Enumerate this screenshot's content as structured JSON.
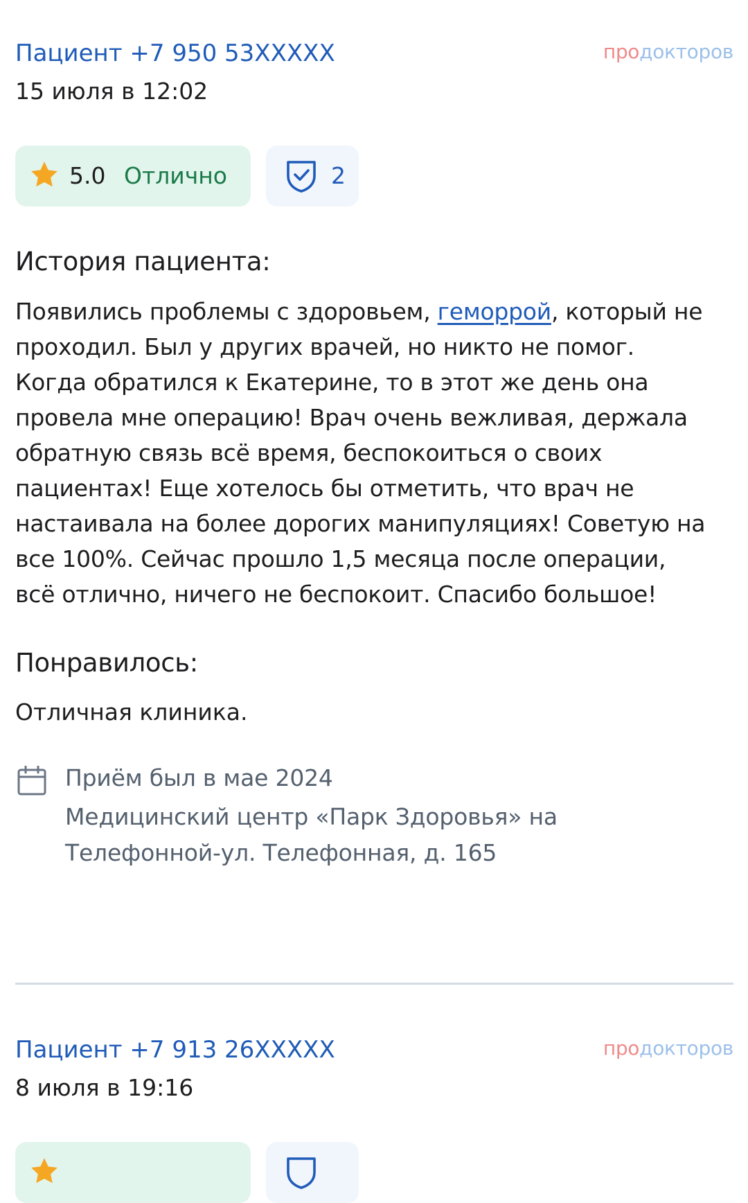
{
  "brand": {
    "part1": "про",
    "part2": "докторов"
  },
  "reviews": [
    {
      "patient": "Пациент +7 950 53XXXXX",
      "date": "15 июля в 12:02",
      "rating": "5.0",
      "rating_word": "Отлично",
      "verified_count": "2",
      "story_title": "История пациента:",
      "story_before_link": "Появились проблемы с здоровьем, ",
      "story_link": "геморрой",
      "story_after_link": ", который не проходил. Был у других врачей, но никто не помог. Когда обратился к Екатерине, то в этот же день она провела мне операцию! Врач очень вежливая, держала обратную связь всё время, беспокоиться о своих пациентах! Еще хотелось бы отметить, что врач не настаивала на более дорогих манипуляциях! Советую на все 100%. Сейчас прошло 1,5 месяца после операции, всё отлично, ничего не беспокоит. Спасибо большое!",
      "liked_title": "Понравилось:",
      "liked_text": "Отличная клиника.",
      "visit_date": "Приём был в мае 2024",
      "visit_clinic": "Медицинский центр «Парк Здоровья» на Телефонной-ул. Телефонная, д. 165"
    },
    {
      "patient": "Пациент +7 913 26XXXXX",
      "date": "8 июля в 19:16"
    }
  ],
  "colors": {
    "link_blue": "#1f5bb8",
    "rating_green_bg": "#e2f5ec",
    "rating_green_text": "#1b7a49",
    "star": "#f5a623",
    "brand_pink": "#f08a8a",
    "brand_blue": "#9cc0ea"
  },
  "icons": {
    "rating": "star-icon",
    "verified": "shield-check-icon",
    "visit": "calendar-icon"
  }
}
